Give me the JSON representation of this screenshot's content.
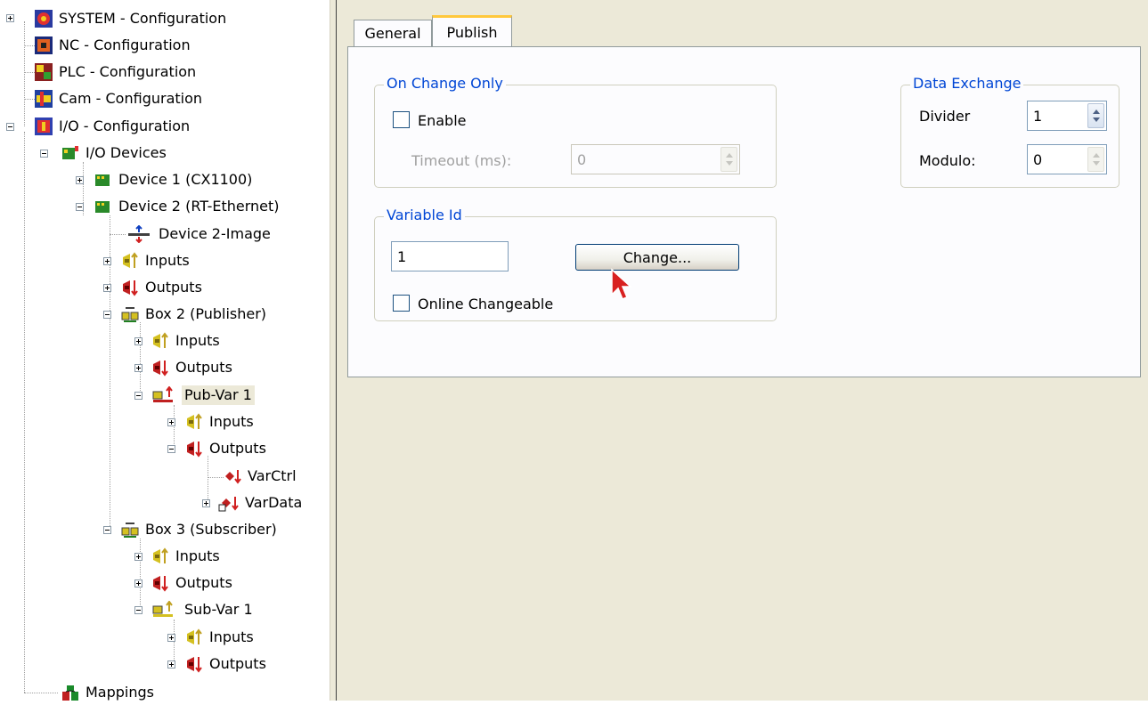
{
  "tree": {
    "items": [
      {
        "label": "SYSTEM - Configuration"
      },
      {
        "label": "NC - Configuration"
      },
      {
        "label": "PLC - Configuration"
      },
      {
        "label": "Cam - Configuration"
      },
      {
        "label": "I/O - Configuration"
      },
      {
        "label": "I/O Devices"
      },
      {
        "label": "Device 1 (CX1100)"
      },
      {
        "label": "Device 2 (RT-Ethernet)"
      },
      {
        "label": "Device 2-Image"
      },
      {
        "label": "Inputs"
      },
      {
        "label": "Outputs"
      },
      {
        "label": "Box 2 (Publisher)"
      },
      {
        "label": "Inputs"
      },
      {
        "label": "Outputs"
      },
      {
        "label": "Pub-Var 1"
      },
      {
        "label": "Inputs"
      },
      {
        "label": "Outputs"
      },
      {
        "label": "VarCtrl"
      },
      {
        "label": "VarData"
      },
      {
        "label": "Box 3 (Subscriber)"
      },
      {
        "label": "Inputs"
      },
      {
        "label": "Outputs"
      },
      {
        "label": "Sub-Var 1"
      },
      {
        "label": "Inputs"
      },
      {
        "label": "Outputs"
      },
      {
        "label": "Mappings"
      }
    ]
  },
  "tabs": [
    {
      "label": "General"
    },
    {
      "label": "Publish"
    }
  ],
  "publish": {
    "on_change": {
      "title": "On Change Only",
      "enable_label": "Enable",
      "timeout_label": "Timeout (ms):",
      "timeout_value": "0"
    },
    "data_exchange": {
      "title": "Data Exchange",
      "divider_label": "Divider",
      "divider_value": "1",
      "modulo_label": "Modulo:",
      "modulo_value": "0"
    },
    "variable_id": {
      "title": "Variable Id",
      "value": "1",
      "change_button": "Change...",
      "online_label": "Online Changeable"
    }
  },
  "colors": {
    "group_title": "#0046d5",
    "active_tab_accent": "#ffc83c",
    "panel_bg": "#fcfcfe",
    "window_bg": "#ece9d8"
  }
}
